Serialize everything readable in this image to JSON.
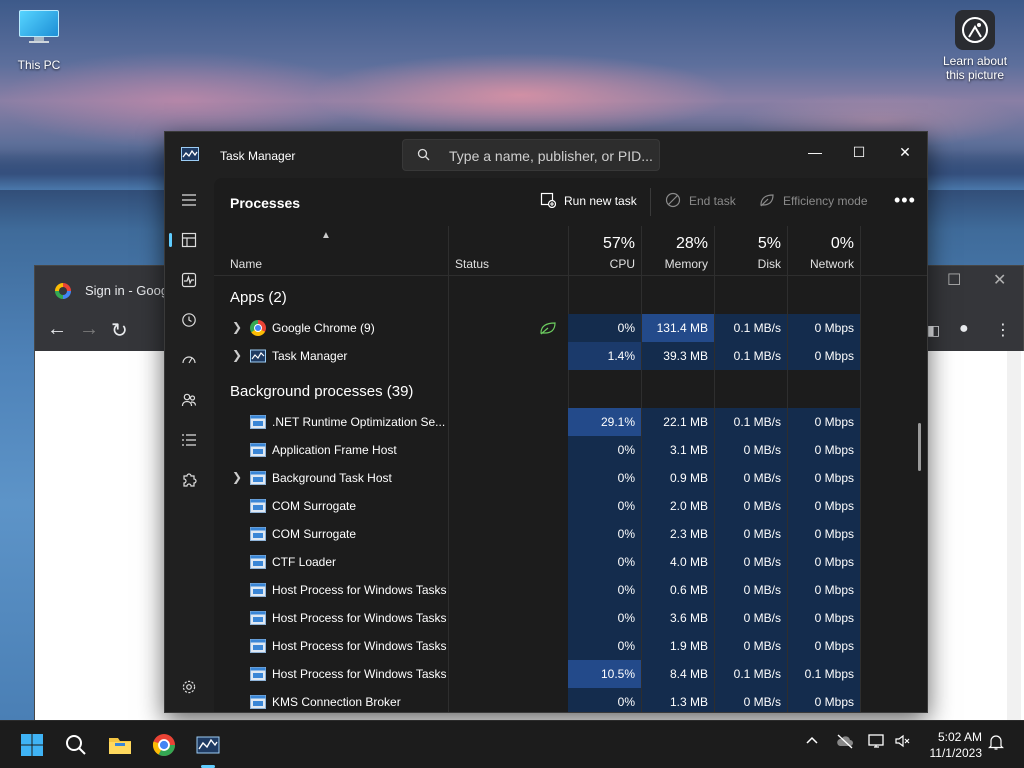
{
  "desktop": {
    "icons": [
      {
        "label": "This PC"
      },
      {
        "label": "Learn about this picture"
      }
    ]
  },
  "chrome_window": {
    "tab_title": "Sign in - Google"
  },
  "task_manager": {
    "title": "Task Manager",
    "search_placeholder": "Type a name, publisher, or PID...",
    "page_title": "Processes",
    "toolbar": {
      "run_new_task": "Run new task",
      "end_task": "End task",
      "efficiency_mode": "Efficiency mode"
    },
    "columns": {
      "name": "Name",
      "status": "Status",
      "cpu": {
        "label": "CPU",
        "pct": "57%"
      },
      "memory": {
        "label": "Memory",
        "pct": "28%"
      },
      "disk": {
        "label": "Disk",
        "pct": "5%"
      },
      "network": {
        "label": "Network",
        "pct": "0%"
      }
    },
    "groups": {
      "apps": "Apps (2)",
      "background": "Background processes (39)"
    },
    "apps": [
      {
        "name": "Google Chrome (9)",
        "cpu": "0%",
        "memory": "131.4 MB",
        "disk": "0.1 MB/s",
        "network": "0 Mbps"
      },
      {
        "name": "Task Manager",
        "cpu": "1.4%",
        "memory": "39.3 MB",
        "disk": "0.1 MB/s",
        "network": "0 Mbps"
      }
    ],
    "background": [
      {
        "name": ".NET Runtime Optimization Se...",
        "cpu": "29.1%",
        "memory": "22.1 MB",
        "disk": "0.1 MB/s",
        "network": "0 Mbps"
      },
      {
        "name": "Application Frame Host",
        "cpu": "0%",
        "memory": "3.1 MB",
        "disk": "0 MB/s",
        "network": "0 Mbps"
      },
      {
        "name": "Background Task Host",
        "cpu": "0%",
        "memory": "0.9 MB",
        "disk": "0 MB/s",
        "network": "0 Mbps"
      },
      {
        "name": "COM Surrogate",
        "cpu": "0%",
        "memory": "2.0 MB",
        "disk": "0 MB/s",
        "network": "0 Mbps"
      },
      {
        "name": "COM Surrogate",
        "cpu": "0%",
        "memory": "2.3 MB",
        "disk": "0 MB/s",
        "network": "0 Mbps"
      },
      {
        "name": "CTF Loader",
        "cpu": "0%",
        "memory": "4.0 MB",
        "disk": "0 MB/s",
        "network": "0 Mbps"
      },
      {
        "name": "Host Process for Windows Tasks",
        "cpu": "0%",
        "memory": "0.6 MB",
        "disk": "0 MB/s",
        "network": "0 Mbps"
      },
      {
        "name": "Host Process for Windows Tasks",
        "cpu": "0%",
        "memory": "3.6 MB",
        "disk": "0 MB/s",
        "network": "0 Mbps"
      },
      {
        "name": "Host Process for Windows Tasks",
        "cpu": "0%",
        "memory": "1.9 MB",
        "disk": "0 MB/s",
        "network": "0 Mbps"
      },
      {
        "name": "Host Process for Windows Tasks",
        "cpu": "10.5%",
        "memory": "8.4 MB",
        "disk": "0.1 MB/s",
        "network": "0.1 Mbps"
      },
      {
        "name": "KMS Connection Broker",
        "cpu": "0%",
        "memory": "1.3 MB",
        "disk": "0 MB/s",
        "network": "0 Mbps"
      }
    ]
  },
  "taskbar": {
    "time": "5:02 AM",
    "date": "11/1/2023"
  },
  "colors": {
    "accent": "#60cdff",
    "heat_low": "#142c4d",
    "heat_mid": "#1b3a6b",
    "heat_high": "#234a8a"
  }
}
